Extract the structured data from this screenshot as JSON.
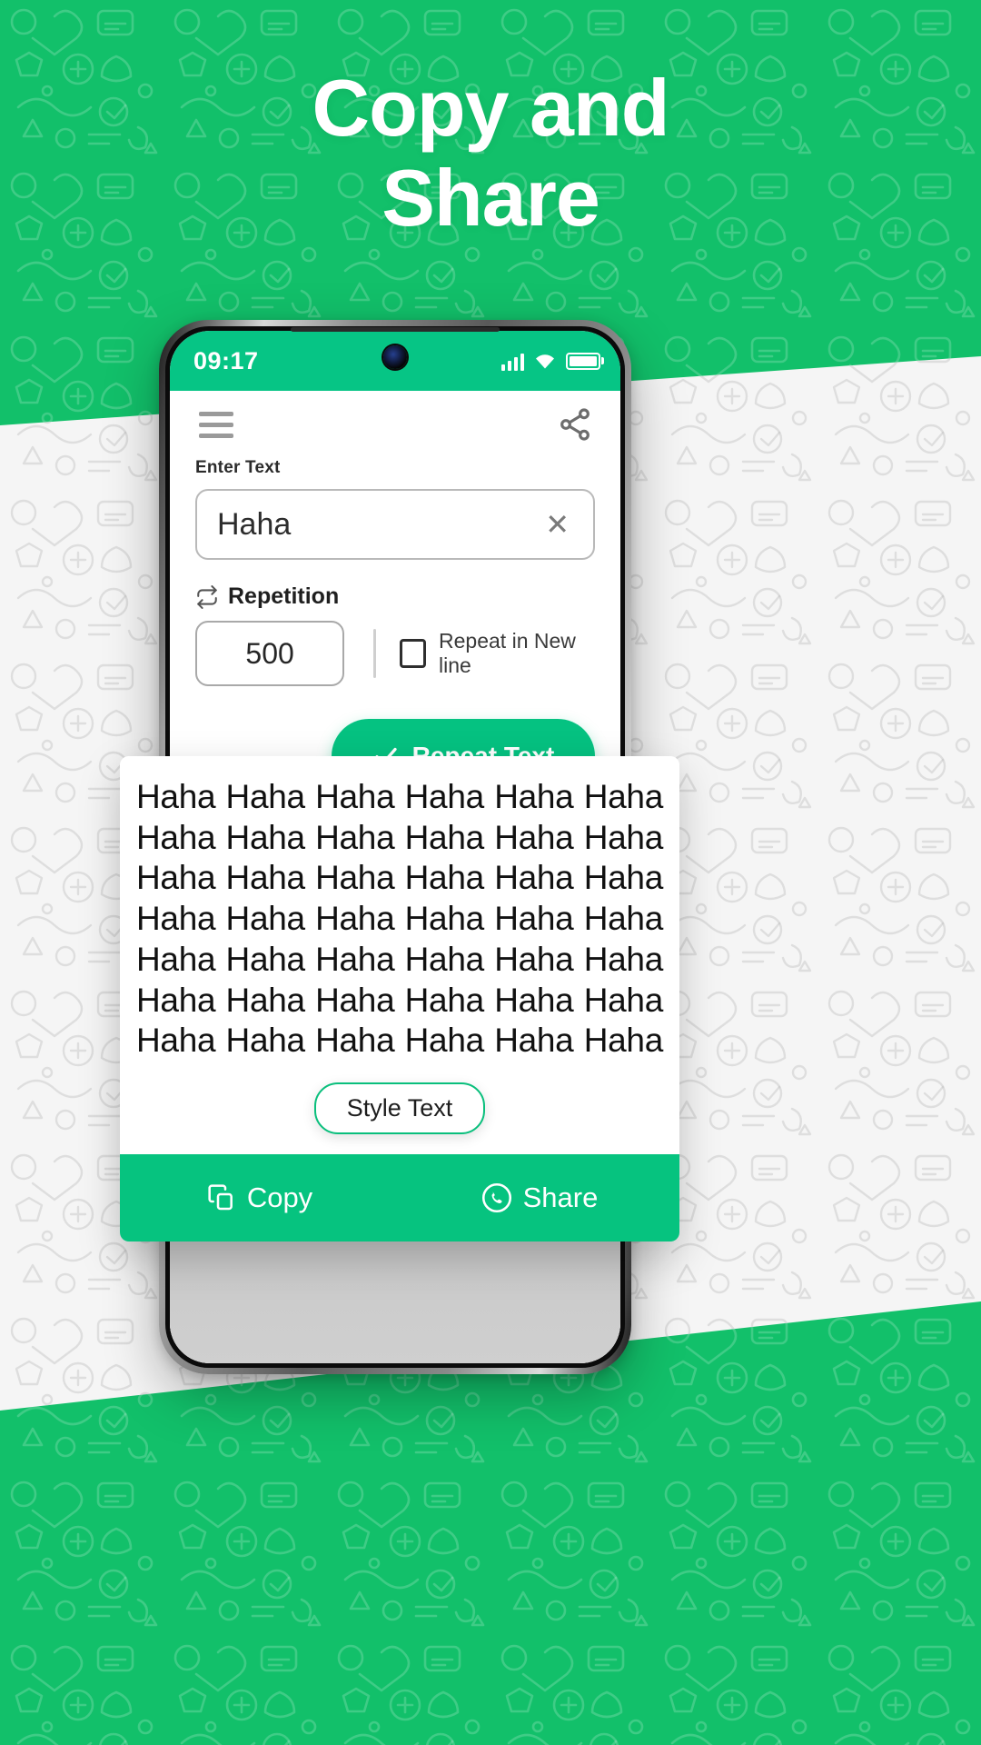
{
  "theme": {
    "brand_green": "#12C06A",
    "status_green": "#06C585",
    "button_green": "#05C281",
    "action_bar_green": "#06C37F",
    "card_white": "#FFFFFF",
    "grey_panel": "#C9C9C9"
  },
  "headline": {
    "line1": "Copy and",
    "line2": "Share"
  },
  "phone": {
    "status_bar": {
      "time": "09:17",
      "icons": [
        "signal-icon",
        "wifi-icon",
        "battery-icon"
      ]
    },
    "app_bar": {
      "menu_icon": "hamburger-menu-icon",
      "share_icon": "share-icon"
    },
    "form": {
      "enter_text_label": "Enter Text",
      "enter_text_value": "Haha",
      "enter_text_placeholder": "Enter Text",
      "clear_icon": "close-x-icon",
      "repetition_icon": "repeat-loop-icon",
      "repetition_label": "Repetition",
      "repetition_value": "500",
      "repetition_placeholder": "500",
      "new_line_checkbox_checked": false,
      "new_line_label": "Repeat in New line",
      "repeat_button_label": "Repeat Text",
      "repeat_button_icon": "check-icon"
    }
  },
  "result_card": {
    "word": "Haha",
    "columns": 6,
    "rows": 7,
    "lines": [
      [
        "Haha",
        "Haha",
        "Haha",
        "Haha",
        "Haha",
        "Haha"
      ],
      [
        "Haha",
        "Haha",
        "Haha",
        "Haha",
        "Haha",
        "Haha"
      ],
      [
        "Haha",
        "Haha",
        "Haha",
        "Haha",
        "Haha",
        "Haha"
      ],
      [
        "Haha",
        "Haha",
        "Haha",
        "Haha",
        "Haha",
        "Haha"
      ],
      [
        "Haha",
        "Haha",
        "Haha",
        "Haha",
        "Haha",
        "Haha"
      ],
      [
        "Haha",
        "Haha",
        "Haha",
        "Haha",
        "Haha",
        "Haha"
      ],
      [
        "Haha",
        "Haha",
        "Haha",
        "Haha",
        "Haha",
        "Haha"
      ]
    ],
    "style_button_label": "Style Text",
    "copy_label": "Copy",
    "copy_icon": "copy-icon",
    "share_label": "Share",
    "share_icon": "whatsapp-share-icon"
  }
}
